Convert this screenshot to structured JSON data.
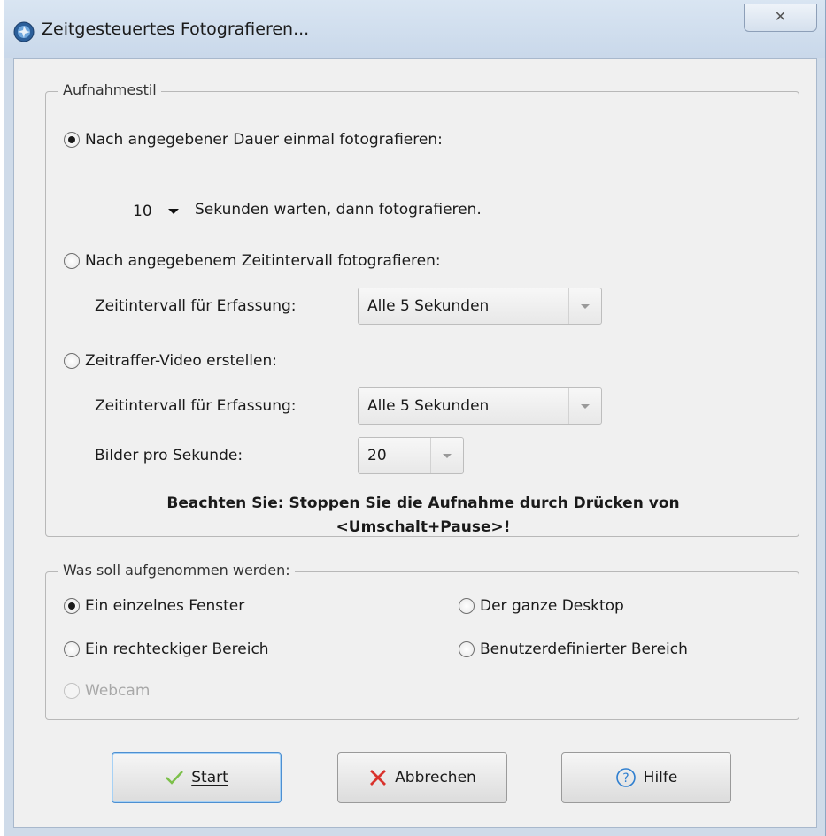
{
  "window": {
    "title": "Zeitgesteuertes Fotografieren...",
    "close_glyph": "✕"
  },
  "capture_style": {
    "group_label": "Aufnahmestil",
    "option_once": {
      "label": "Nach angegebener Dauer einmal fotografieren:",
      "checked": true,
      "seconds_value": "10",
      "seconds_suffix": "Sekunden warten, dann fotografieren."
    },
    "option_interval": {
      "label": "Nach angegebenem Zeitintervall fotografieren:",
      "checked": false,
      "interval_label": "Zeitintervall für Erfassung:",
      "interval_value": "Alle 5 Sekunden"
    },
    "option_timelapse": {
      "label": "Zeitraffer-Video erstellen:",
      "checked": false,
      "interval_label": "Zeitintervall für Erfassung:",
      "interval_value": "Alle 5 Sekunden",
      "fps_label": "Bilder pro Sekunde:",
      "fps_value": "20"
    },
    "note_line1": "Beachten Sie: Stoppen Sie die Aufnahme durch Drücken von",
    "note_line2": "<Umschalt+Pause>!"
  },
  "capture_target": {
    "group_label": "Was soll aufgenommen werden:",
    "options": [
      {
        "label": "Ein einzelnes Fenster",
        "checked": true,
        "enabled": true
      },
      {
        "label": "Der ganze Desktop",
        "checked": false,
        "enabled": true
      },
      {
        "label": "Ein rechteckiger Bereich",
        "checked": false,
        "enabled": true
      },
      {
        "label": "Benutzerdefinierter Bereich",
        "checked": false,
        "enabled": true
      },
      {
        "label": "Webcam",
        "checked": false,
        "enabled": false
      }
    ]
  },
  "buttons": {
    "start": "Start",
    "cancel": "Abbrechen",
    "help": "Hilfe"
  },
  "icons": {
    "app": "camera-shutter-icon",
    "start": "checkmark-icon",
    "cancel": "x-icon",
    "help": "question-circle-icon"
  },
  "colors": {
    "start_check": "#7cc04a",
    "cancel_x": "#d9322c",
    "help_blue": "#2f7fd0"
  }
}
